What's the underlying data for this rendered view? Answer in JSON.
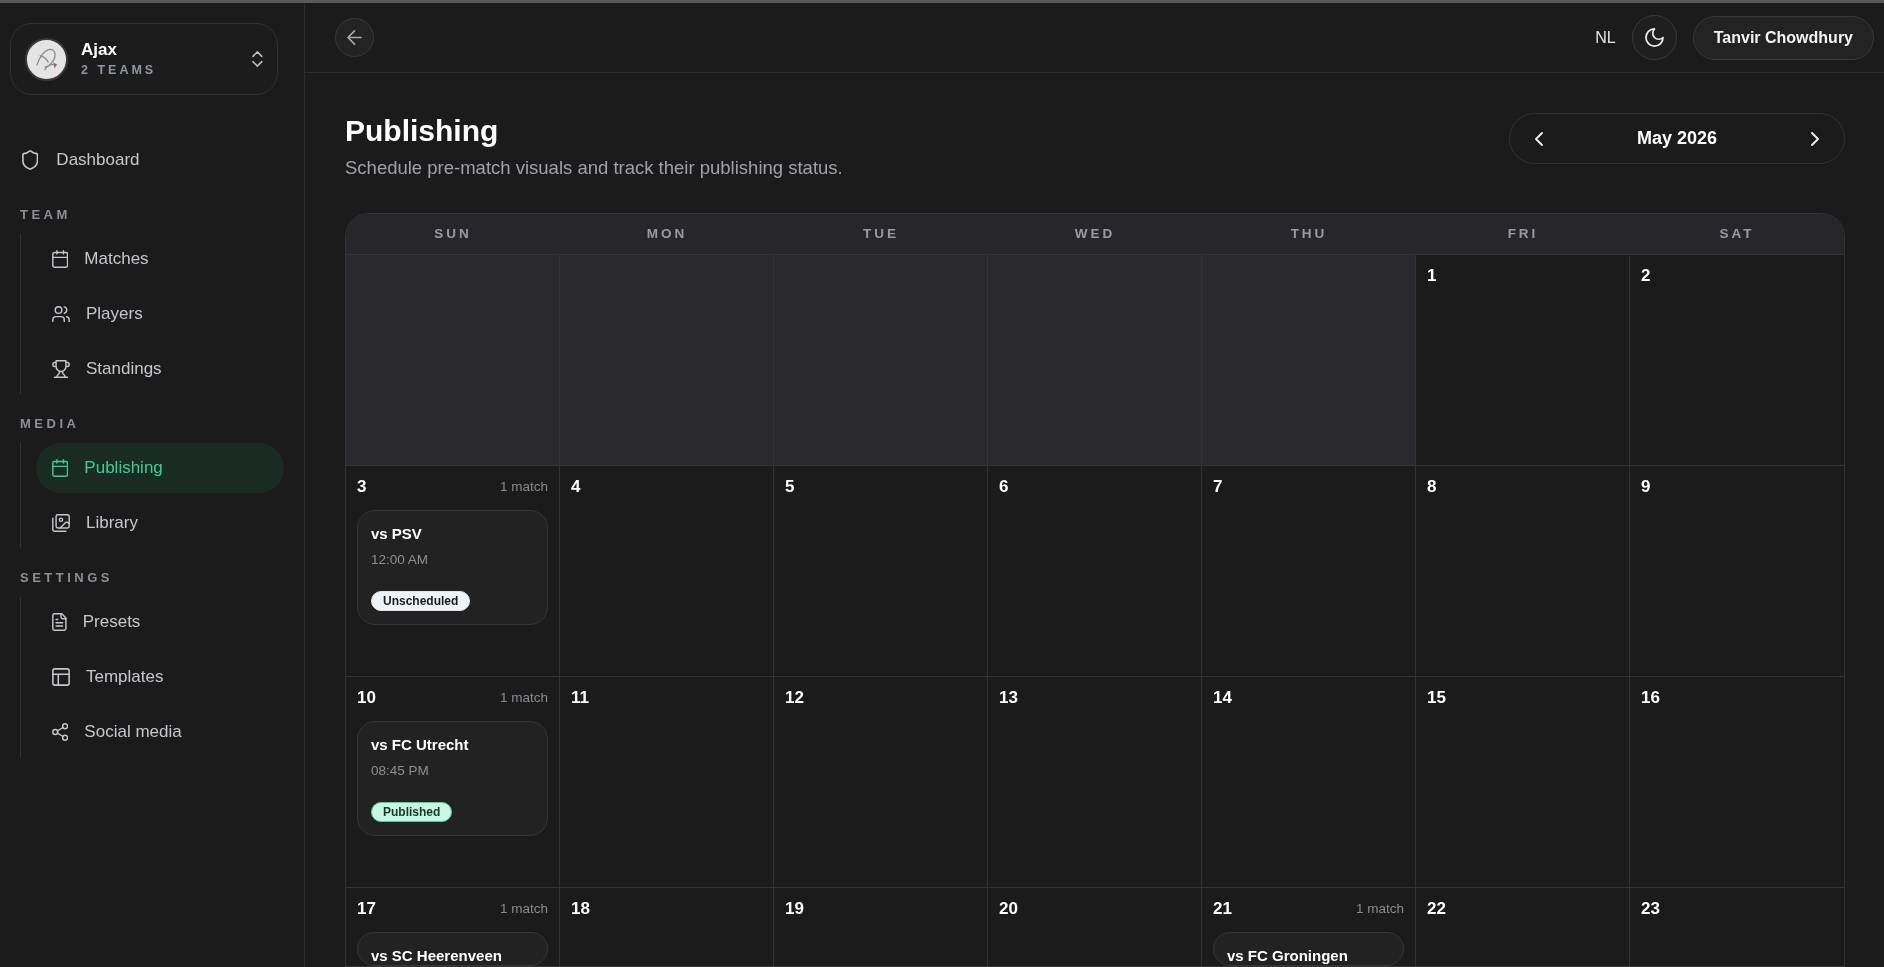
{
  "sidebar": {
    "team": {
      "name": "Ajax",
      "subtitle": "2 TEAMS"
    },
    "nav": [
      {
        "label": "Dashboard",
        "selected": false
      }
    ],
    "sections": [
      {
        "title": "TEAM",
        "items": [
          {
            "label": "Matches",
            "selected": false
          },
          {
            "label": "Players",
            "selected": false
          },
          {
            "label": "Standings",
            "selected": false
          }
        ]
      },
      {
        "title": "MEDIA",
        "items": [
          {
            "label": "Publishing",
            "selected": true
          },
          {
            "label": "Library",
            "selected": false
          }
        ]
      },
      {
        "title": "SETTINGS",
        "items": [
          {
            "label": "Presets",
            "selected": false
          },
          {
            "label": "Templates",
            "selected": false
          },
          {
            "label": "Social media",
            "selected": false
          }
        ]
      }
    ]
  },
  "topbar": {
    "language": "NL",
    "user": "Tanvir Chowdhury"
  },
  "page": {
    "title": "Publishing",
    "subtitle": "Schedule pre-match visuals and track their publishing status."
  },
  "month_nav": {
    "label": "May 2026"
  },
  "calendar": {
    "weekdays": [
      "SUN",
      "MON",
      "TUE",
      "WED",
      "THU",
      "FRI",
      "SAT"
    ],
    "weeks": [
      {
        "days": [
          {
            "in_month": false
          },
          {
            "in_month": false
          },
          {
            "in_month": false
          },
          {
            "in_month": false
          },
          {
            "in_month": false
          },
          {
            "in_month": true,
            "date": "1"
          },
          {
            "in_month": true,
            "date": "2"
          }
        ]
      },
      {
        "days": [
          {
            "in_month": true,
            "date": "3",
            "count": "1 match",
            "events": [
              {
                "title": "vs PSV",
                "time": "12:00 AM",
                "status": {
                  "label": "Unscheduled",
                  "kind": "unscheduled"
                }
              }
            ]
          },
          {
            "in_month": true,
            "date": "4"
          },
          {
            "in_month": true,
            "date": "5"
          },
          {
            "in_month": true,
            "date": "6"
          },
          {
            "in_month": true,
            "date": "7"
          },
          {
            "in_month": true,
            "date": "8"
          },
          {
            "in_month": true,
            "date": "9"
          }
        ]
      },
      {
        "days": [
          {
            "in_month": true,
            "date": "10",
            "count": "1 match",
            "events": [
              {
                "title": "vs FC Utrecht",
                "time": "08:45 PM",
                "status": {
                  "label": "Published",
                  "kind": "published"
                }
              }
            ]
          },
          {
            "in_month": true,
            "date": "11"
          },
          {
            "in_month": true,
            "date": "12"
          },
          {
            "in_month": true,
            "date": "13"
          },
          {
            "in_month": true,
            "date": "14"
          },
          {
            "in_month": true,
            "date": "15"
          },
          {
            "in_month": true,
            "date": "16"
          }
        ]
      },
      {
        "days": [
          {
            "in_month": true,
            "date": "17",
            "count": "1 match",
            "events": [
              {
                "title": "vs SC Heerenveen"
              }
            ]
          },
          {
            "in_month": true,
            "date": "18"
          },
          {
            "in_month": true,
            "date": "19"
          },
          {
            "in_month": true,
            "date": "20"
          },
          {
            "in_month": true,
            "date": "21",
            "count": "1 match",
            "events": [
              {
                "title": "vs FC Groningen"
              }
            ]
          },
          {
            "in_month": true,
            "date": "22"
          },
          {
            "in_month": true,
            "date": "23"
          }
        ]
      }
    ]
  }
}
